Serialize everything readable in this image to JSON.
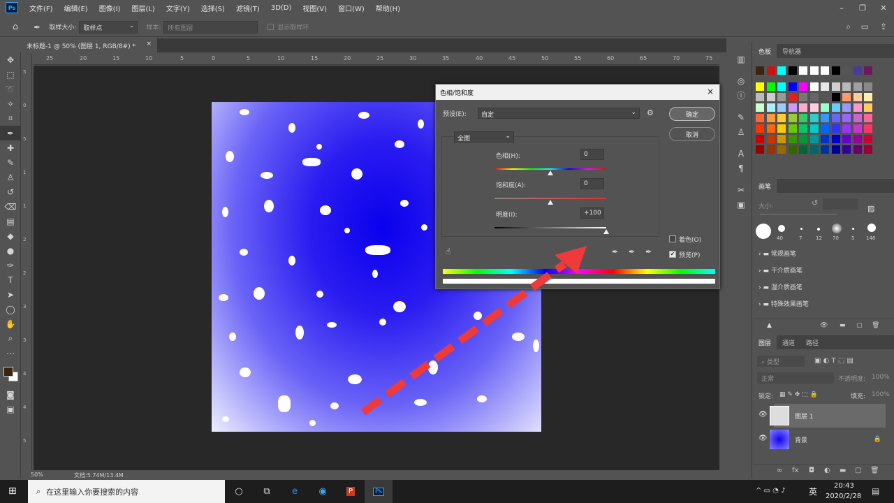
{
  "menu": {
    "app_icon": "Ps",
    "items": [
      "文件(F)",
      "编辑(E)",
      "图像(I)",
      "图层(L)",
      "文字(Y)",
      "选择(S)",
      "滤镜(T)",
      "3D(D)",
      "视图(V)",
      "窗口(W)",
      "帮助(H)"
    ]
  },
  "window_controls": {
    "minimize": "–",
    "restore": "❐",
    "close": "✕"
  },
  "options_bar": {
    "sample_size_label": "取样大小:",
    "sample_size_value": "取样点",
    "sample_label": "样本:",
    "sample_value": "所有图层",
    "show_ring_label": "显示取样环"
  },
  "document": {
    "tab_title": "未标题-1 @ 50% (图层 1, RGB/8#) *",
    "tab_close": "×",
    "ruler_ticks": [
      "25",
      "20",
      "15",
      "10",
      "5",
      "0",
      "5",
      "10",
      "15",
      "20",
      "25",
      "30",
      "35",
      "40",
      "45",
      "50",
      "55",
      "60",
      "65",
      "70",
      "75"
    ],
    "ruler_left_ticks": [
      "5",
      "0",
      "5",
      "1",
      "1",
      "2",
      "2",
      "3",
      "3",
      "4",
      "4",
      "5"
    ],
    "zoom": "50%",
    "doc_size": "文档:5.74M/13.4M"
  },
  "dialog": {
    "title": "色相/饱和度",
    "close": "×",
    "preset_label": "预设(E):",
    "preset_value": "自定",
    "channel_value": "全图",
    "hue_label": "色相(H):",
    "hue_value": "0",
    "saturation_label": "饱和度(A):",
    "saturation_value": "0",
    "lightness_label": "明度(I):",
    "lightness_value": "+100",
    "ok_label": "确定",
    "cancel_label": "取消",
    "colorize_label": "着色(O)",
    "colorize_checked": false,
    "preview_label": "预览(P)",
    "preview_checked": true,
    "hue_level": 0.5,
    "saturation_level": 0.5,
    "lightness_level": 1.0
  },
  "panels": {
    "swatches_tabs": [
      "色板",
      "导航器"
    ],
    "brushes_tab": "画笔",
    "brush_size_label": "大小:",
    "brush_presets": [
      "40",
      "7",
      "12",
      "70",
      "5",
      "146"
    ],
    "brush_folders": [
      "常规画笔",
      "干介质画笔",
      "湿介质画笔",
      "特殊效果画笔"
    ],
    "layers_tabs": [
      "图层",
      "通道",
      "路径"
    ],
    "layer_filter": "类型",
    "blend_mode": "正常",
    "opacity_label": "不透明度:",
    "opacity_value": "100%",
    "lock_label": "锁定:",
    "fill_label": "填充:",
    "fill_value": "100%",
    "layers": [
      {
        "name": "图层 1",
        "selected": true
      },
      {
        "name": "背景",
        "selected": false
      }
    ]
  },
  "colors": {
    "accent": "#31a8ff",
    "arrow": "#ee3a3a",
    "foreground": "#3a2510",
    "background": "#ffffff"
  },
  "taskbar": {
    "search_placeholder": "在这里输入你要搜索的内容",
    "ime": "英",
    "time": "20:43",
    "date": "2020/2/28",
    "apps": [
      "cortana-icon",
      "task-view-icon",
      "edge-icon",
      "browser-icon",
      "powerpoint-icon",
      "photoshop-icon"
    ]
  }
}
